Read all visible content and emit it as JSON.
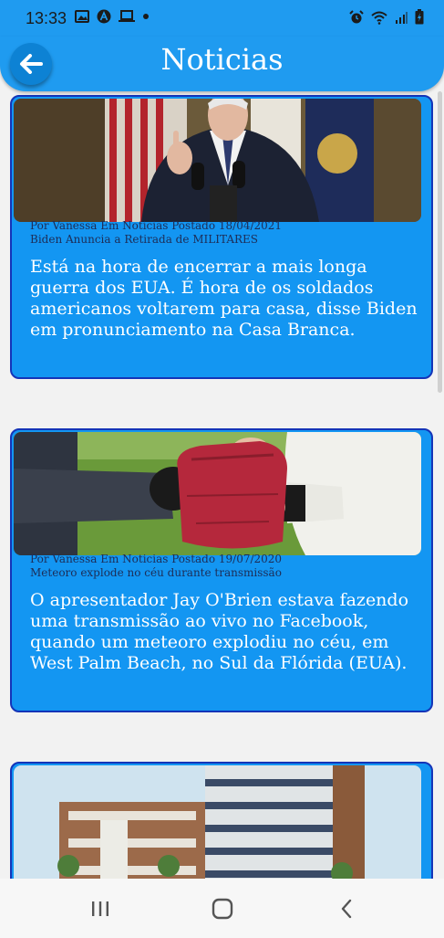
{
  "status_bar": {
    "time": "13:33"
  },
  "header": {
    "title": "Noticias"
  },
  "posts": [
    {
      "meta": "Por Vanessa Em Noticias Postado 18/04/2021",
      "subtitle": "Biden Anuncia a Retirada de MILITARES",
      "body": "Está na hora de encerrar a mais longa guerra dos EUA. É hora de os soldados americanos voltarem para casa, disse Biden em pronunciamento na Casa Branca."
    },
    {
      "meta": "Por Vanessa Em Noticias Postado 19/07/2020",
      "subtitle": "Meteoro explode no céu durante transmissão",
      "body": "O apresentador Jay O'Brien estava fazendo uma transmissão ao vivo no Facebook, quando um meteoro explodiu no céu, em West Palm Beach, no Sul da Flórida (EUA)."
    }
  ],
  "colors": {
    "primary": "#1f9bf0",
    "card": "#1396f2",
    "card_border": "#1434b8",
    "meta_text": "#1d2d57"
  },
  "icons": [
    "back-arrow-icon",
    "recent-apps-icon",
    "home-icon",
    "nav-back-icon",
    "alarm-icon",
    "wifi-icon",
    "signal-icon",
    "battery-icon",
    "image-icon",
    "a-icon",
    "laptop-icon",
    "dot-icon"
  ]
}
